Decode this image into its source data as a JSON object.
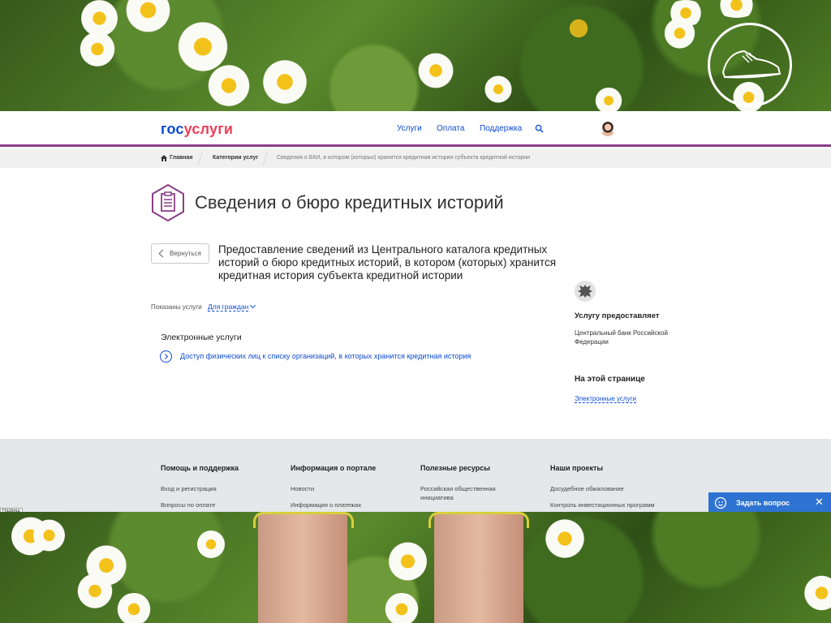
{
  "header": {
    "brand_part1": "гос",
    "brand_part2": "услуги",
    "nav": [
      "Услуги",
      "Оплата",
      "Поддержка"
    ]
  },
  "breadcrumbs": {
    "home": "Главная",
    "categories": "Категории услуг",
    "current": "Сведения о БКИ, в котором (которых) хранится кредитная история субъекта кредитной истории"
  },
  "main": {
    "title": "Сведения о бюро кредитных историй",
    "back_label": "Вернуться",
    "subtitle": "Предоставление сведений из Центрального каталога кредитных историй о бюро кредитных историй, в котором (которых) хранится кредитная история субъекта кредитной истории",
    "shown_label": "Показаны услуги",
    "shown_value": "Для граждан",
    "section_title": "Электронные услуги",
    "service_link": "Доступ физических лиц к списку организаций, в которых хранится кредитная история"
  },
  "sidebar": {
    "provider_heading": "Услугу предоставляет",
    "provider_name": "Центральный банк Российской Федерации",
    "onpage_heading": "На этой странице",
    "onpage_link": "Электронные услуги"
  },
  "footer": {
    "columns": [
      {
        "title": "Помощь и поддержка",
        "links": [
          "Вход и регистрация",
          "Вопросы по оплате"
        ]
      },
      {
        "title": "Информация о портале",
        "links": [
          "Новости",
          "Информация о платежах"
        ]
      },
      {
        "title": "Полезные ресурсы",
        "links": [
          "Российская общественная инициатива"
        ]
      },
      {
        "title": "Наши проекты",
        "links": [
          "Досудебное обжалование",
          "Контроль инвестиционных программ"
        ]
      }
    ],
    "notice": "Назвищ"
  },
  "chat": {
    "label": "Задать вопрос",
    "close": "✕"
  },
  "colors": {
    "brand_blue": "#0d4cd3",
    "brand_red": "#ee3f58",
    "header_line": "#8b3f87",
    "chat_blue": "#2e73d1"
  },
  "icons": [
    "search-icon",
    "home-icon",
    "document-list-icon",
    "chevron-left-icon",
    "arrow-circle-icon",
    "emblem-icon",
    "support-agent-icon",
    "close-icon",
    "sneaker-logo-icon"
  ]
}
